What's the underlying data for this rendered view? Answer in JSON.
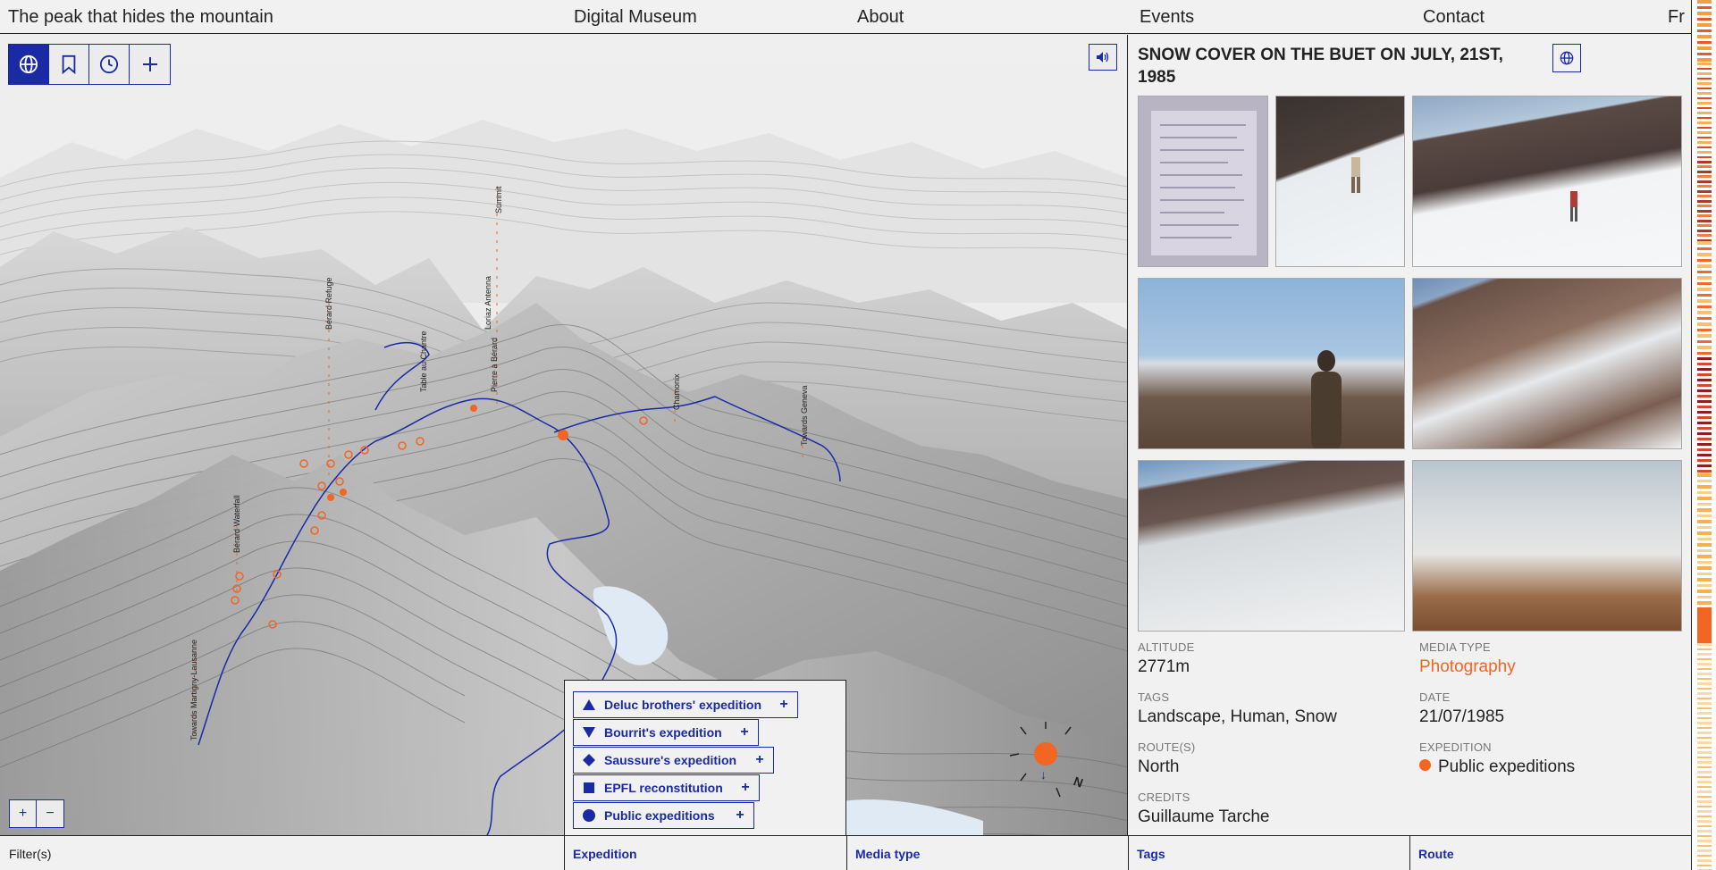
{
  "nav": {
    "site_title": "The peak that hides the mountain",
    "digital_museum": "Digital Museum",
    "about": "About",
    "events": "Events",
    "contact": "Contact",
    "lang": "Fr"
  },
  "map": {
    "toolbar": [
      "globe-icon",
      "bookmark-icon",
      "clock-icon",
      "plus-icon"
    ],
    "zoom_in": "+",
    "zoom_out": "−",
    "labels": {
      "towards_martigny": "Towards Martigny-Lausanne",
      "berard_waterfall": "Bérard Waterfall",
      "berard_refuge": "Bérard Refuge",
      "table_au_chantre": "Table au Chantre",
      "loriaz_antenna": "Loriaz Antenna",
      "pierre_a_berard": "Pierre à Bérard",
      "summit": "Summit",
      "chamonix": "Chamonix",
      "towards_geneva": "Towards Geneva"
    },
    "compass_label": "N"
  },
  "legend": {
    "items": [
      {
        "label": "Deluc brothers' expedition",
        "shape": "triangle-up",
        "plus": "+"
      },
      {
        "label": "Bourrit's expedition",
        "shape": "triangle-down",
        "plus": "+"
      },
      {
        "label": "Saussure's expedition",
        "shape": "diamond",
        "plus": "+"
      },
      {
        "label": "EPFL reconstitution",
        "shape": "square",
        "plus": "+"
      },
      {
        "label": "Public expeditions",
        "shape": "circle",
        "plus": "+"
      }
    ]
  },
  "filters": {
    "filters_label": "Filter(s)",
    "expedition": "Expedition",
    "media_type": "Media type",
    "tags": "Tags",
    "route": "Route"
  },
  "panel": {
    "title": "SNOW COVER ON THE BUET ON JULY, 21ST, 1985",
    "altitude_label": "ALTITUDE",
    "altitude": "2771m",
    "media_type_label": "MEDIA TYPE",
    "media_type": "Photography",
    "tags_label": "TAGS",
    "tags": "Landscape, Human, Snow",
    "date_label": "DATE",
    "date": "21/07/1985",
    "routes_label": "ROUTE(S)",
    "routes": "North",
    "expedition_label": "EXPEDITION",
    "expedition": "Public expeditions",
    "credits_label": "CREDITS",
    "credits": "Guillaume Tarche"
  },
  "colors": {
    "accent_blue": "#1a2aa5",
    "accent_orange": "#f26522"
  }
}
